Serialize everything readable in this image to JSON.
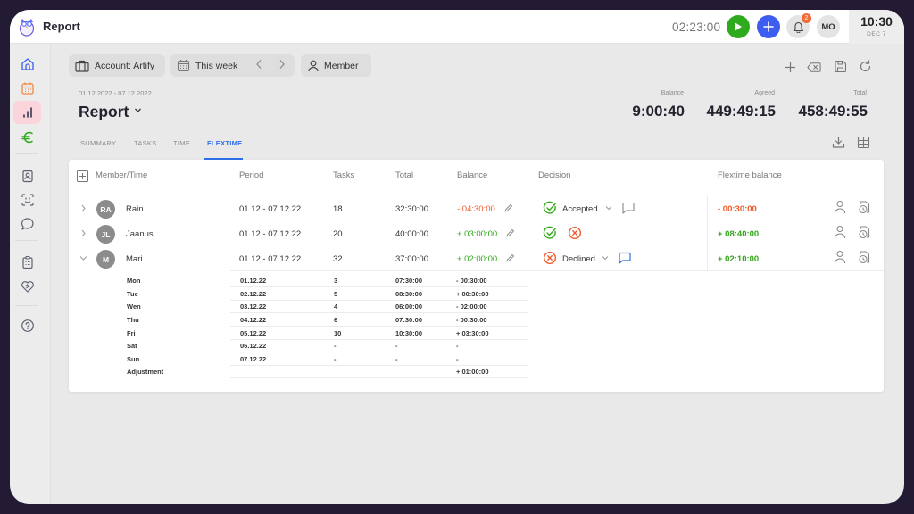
{
  "app": {
    "title": "Report",
    "timer": "02:23:00",
    "notifications_count": "2",
    "user_initials": "MO",
    "clock_time": "10:30",
    "clock_date": "DEC 7"
  },
  "sidebar": {
    "items": [
      {
        "name": "home",
        "icon": "home-icon",
        "color": "#3d5cf0"
      },
      {
        "name": "calendar",
        "icon": "calendar-icon",
        "color": "#f08a4b"
      },
      {
        "name": "reports",
        "icon": "bar-chart-icon",
        "color": "#d9334f",
        "active": true
      },
      {
        "name": "finance",
        "icon": "euro-icon",
        "color": "#2eaa1e"
      },
      {
        "name": "contacts",
        "icon": "contact-card-icon",
        "color": "#5d6170"
      },
      {
        "name": "face-scan",
        "icon": "face-scan-icon",
        "color": "#5d6170"
      },
      {
        "name": "chat",
        "icon": "chat-icon",
        "color": "#5d6170"
      },
      {
        "name": "clipboard",
        "icon": "clipboard-icon",
        "color": "#5d6170"
      },
      {
        "name": "handshake",
        "icon": "handshake-heart-icon",
        "color": "#5d6170"
      },
      {
        "name": "help",
        "icon": "help-icon",
        "color": "#5d6170"
      }
    ]
  },
  "filters": {
    "account": "Account: Artify",
    "period": "This week",
    "member": "Member"
  },
  "header": {
    "date_range": "01.12.2022 - 07.12.2022",
    "title": "Report"
  },
  "stats": {
    "balance_label": "Balance",
    "balance_value": "9:00:40",
    "agreed_label": "Agreed",
    "agreed_value": "449:49:15",
    "total_label": "Total",
    "total_value": "458:49:55"
  },
  "tabs": [
    {
      "label": "SUMMARY",
      "active": false
    },
    {
      "label": "TASKS",
      "active": false
    },
    {
      "label": "TIME",
      "active": false
    },
    {
      "label": "FLEXTIME",
      "active": true
    }
  ],
  "table": {
    "columns": [
      "Member/Time",
      "Period",
      "Tasks",
      "Total",
      "Balance",
      "Decision",
      "Flextime balance"
    ],
    "rows": [
      {
        "initials": "RA",
        "name": "Rain",
        "period": "01.12 - 07.12.22",
        "tasks": "18",
        "total": "32:30:00",
        "balance": "- 04:30:00",
        "balance_sign": "negative",
        "decision": "Accepted",
        "flextime_balance": "- 00:30:00",
        "flextime_sign": "negative",
        "expanded": false
      },
      {
        "initials": "JL",
        "name": "Jaanus",
        "period": "01.12 - 07.12.22",
        "tasks": "20",
        "total": "40:00:00",
        "balance": "+ 03:00:00",
        "balance_sign": "positive",
        "decision": "",
        "flextime_balance": "+ 08:40:00",
        "flextime_sign": "positive",
        "expanded": false
      },
      {
        "initials": "M",
        "name": "Mari",
        "period": "01.12 - 07.12.22",
        "tasks": "32",
        "total": "37:00:00",
        "balance": "+ 02:00:00",
        "balance_sign": "positive",
        "decision": "Declined",
        "flextime_balance": "+ 02:10:00",
        "flextime_sign": "positive",
        "expanded": true
      }
    ],
    "details": [
      {
        "day": "Mon",
        "date": "01.12.22",
        "tasks": "3",
        "total": "07:30:00",
        "balance": "-  00:30:00"
      },
      {
        "day": "Tue",
        "date": "02.12.22",
        "tasks": "5",
        "total": "08:30:00",
        "balance": "+ 00:30:00"
      },
      {
        "day": "Wen",
        "date": "03.12.22",
        "tasks": "4",
        "total": "06:00:00",
        "balance": "-  02:00:00"
      },
      {
        "day": "Thu",
        "date": "04.12.22",
        "tasks": "6",
        "total": "07:30:00",
        "balance": "-  00:30:00"
      },
      {
        "day": "Fri",
        "date": "05.12.22",
        "tasks": "10",
        "total": "10:30:00",
        "balance": "+ 03:30:00"
      },
      {
        "day": "Sat",
        "date": "06.12.22",
        "tasks": "-",
        "total": "-",
        "balance": "-"
      },
      {
        "day": "Sun",
        "date": "07.12.22",
        "tasks": "-",
        "total": "-",
        "balance": "-"
      },
      {
        "day": "Adjustment",
        "date": "",
        "tasks": "",
        "total": "",
        "balance": "+ 01:00:00"
      }
    ]
  },
  "colors": {
    "accent": "#2f6fea",
    "negative": "#f15a2d",
    "positive": "#36a81e",
    "play": "#2eaa1e",
    "add": "#3d5cf0"
  }
}
